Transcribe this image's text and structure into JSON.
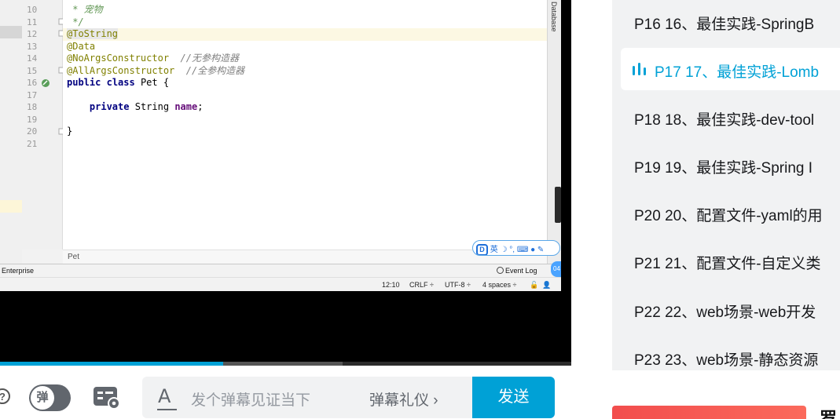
{
  "ide": {
    "line_numbers": [
      "10",
      "11",
      "12",
      "13",
      "14",
      "15",
      "16",
      "17",
      "18",
      "19",
      "20",
      "21"
    ],
    "code": {
      "doc_comment": " * 宠物",
      "doc_end": " */",
      "ann_tostring": "@ToString",
      "ann_data": "@Data",
      "ann_noargs": "@NoArgsConstructor",
      "noargs_comment": "//无参构造器",
      "ann_allargs": "@AllArgsConstructor",
      "allargs_comment": "//全参构造器",
      "kw_public": "public",
      "kw_class": "class",
      "class_name": "Pet {",
      "kw_private": "private",
      "type_string": "String",
      "field_name": "name",
      "semicolon": ";",
      "close_brace": "}"
    },
    "side_label": "Database",
    "breadcrumb": "Pet",
    "status_left": "Enterprise",
    "event_log": "Event Log",
    "badge": "04",
    "ime_label": "英",
    "position": "12:10",
    "line_sep": "CRLF ÷",
    "encoding": "UTF-8 ÷",
    "indent": "4 spaces ÷"
  },
  "player": {
    "progress": 0.39,
    "buffered": 0.6
  },
  "danmaku": {
    "toggle_label": "弹",
    "placeholder": "发个弹幕见证当下",
    "etiquette": "弹幕礼仪 ›",
    "send": "发送"
  },
  "playlist": {
    "items": [
      {
        "label": "P16   16、最佳实践-SpringB"
      },
      {
        "label": "P17   17、最佳实践-Lomb",
        "active": true
      },
      {
        "label": "P18   18、最佳实践-dev-tool"
      },
      {
        "label": "P19   19、最佳实践-Spring I"
      },
      {
        "label": "P20   20、配置文件-yaml的用"
      },
      {
        "label": "P21   21、配置文件-自定义类"
      },
      {
        "label": "P22   22、web场景-web开发"
      },
      {
        "label": "P23   23、web场景-静态资源"
      }
    ],
    "accent": "#00a1d6"
  },
  "partial_text": "罗"
}
